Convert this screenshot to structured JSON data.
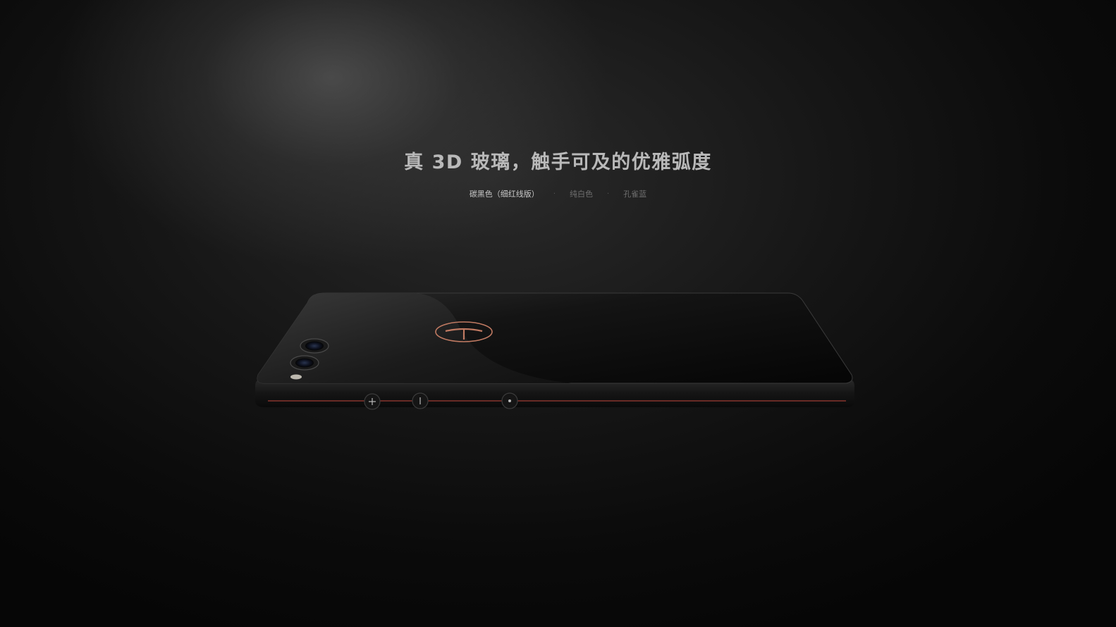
{
  "headline": "真 3D 玻璃，触手可及的优雅弧度",
  "color_options": [
    {
      "label": "碳黑色（细红线版）",
      "active": true
    },
    {
      "label": "纯白色",
      "active": false
    },
    {
      "label": "孔雀蓝",
      "active": false
    }
  ],
  "separator": "·",
  "buttons": {
    "plus": "+",
    "minus": "−",
    "power": "•"
  },
  "colors": {
    "accent_red": "#b8453a",
    "copper": "#c07a62"
  }
}
